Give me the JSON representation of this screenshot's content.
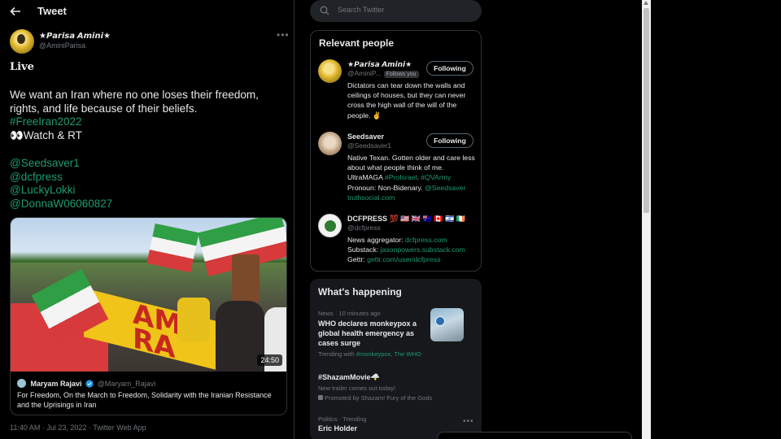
{
  "header": {
    "title": "Tweet"
  },
  "tweet": {
    "author_name": "★𝙋𝙖𝙧𝙞𝙨𝙖 𝘼𝙢𝙞𝙣𝙞★",
    "author_handle": "@AminiParisa",
    "more": "•••",
    "live": "𝐋𝐢𝐯𝐞",
    "line1": "We want an Iran where no one loses their freedom,",
    "line2": "rights, and life because of their beliefs.",
    "hashtag": "#FreeIran2022",
    "watch": "👀Watch & RT",
    "mentions": [
      "@Seedsaver1",
      "@dcfpress",
      "@LuckyLokki",
      "@DonnaW06060827"
    ],
    "video_duration": "24:50",
    "quote_name": "Maryam Rajavi",
    "quote_handle": "@Maryam_Rajavi",
    "quote_text": "For Freedom, On the March to Freedom, Solidarity with the Iranian Resistance and the Uprisings in Iran",
    "meta": "11:40 AM · Jul 23, 2022 · Twitter Web App"
  },
  "search": {
    "placeholder": "Search Twitter"
  },
  "relevant_people": {
    "title": "Relevant people",
    "people": [
      {
        "name": "★𝙋𝙖𝙧𝙞𝙨𝙖 𝘼𝙢𝙞𝙣𝙞★",
        "handle": "@AminiP...",
        "badge": "Follows you",
        "button": "Following",
        "bio": "Dictators can tear down the walls and ceilings of houses, but they can never cross the high wall of the will of the people. ✌️"
      },
      {
        "name": "Seedsaver",
        "handle": "@Seedsaver1",
        "button": "Following",
        "bio_plain1": "Native Texan. Gotten older and care less about what people think of me. UltraMAGA ",
        "bio_tag1": "#ProIsrael",
        "bio_plain2": ". ",
        "bio_tag2": "#QVArmy",
        "bio_plain3": " Pronoun: Non-Bidenary. ",
        "bio_tag3": "@Seedsaver",
        "bio_tag4": "truthsocial.com"
      },
      {
        "name": "DCFPRESS 💯 🇺🇸 🇬🇧 🇦🇺 🇨🇦 🇮🇱 🇮🇪",
        "handle": "@dcfpress",
        "bio_l1": "News aggregator: ",
        "bio_link1": "dcfpress.com",
        "bio_l2": "Substack: ",
        "bio_link2": "jasonpowers.substack.com",
        "bio_l3": "Gettr: ",
        "bio_link3": "gettr.com/user/dcfpress"
      }
    ]
  },
  "whats_happening": {
    "title": "What's happening",
    "trends": [
      {
        "meta": "News · 10 minutes ago",
        "title": "WHO declares monkeypox a global health emergency as cases surge",
        "sub_prefix": "Trending with ",
        "sub_links": "#monkeypox, The WHO"
      },
      {
        "title": "#ShazamMovie🌩️",
        "sub": "New trailer comes out today!",
        "promo": "Promoted by Shazam! Fury of the Gods"
      },
      {
        "meta": "Politics · Trending",
        "title": "Eric Holder",
        "more": "•••"
      }
    ]
  },
  "colors": {
    "accent": "#1d9b6f",
    "background": "#000000",
    "muted": "#71767b",
    "border": "#2f3336"
  }
}
